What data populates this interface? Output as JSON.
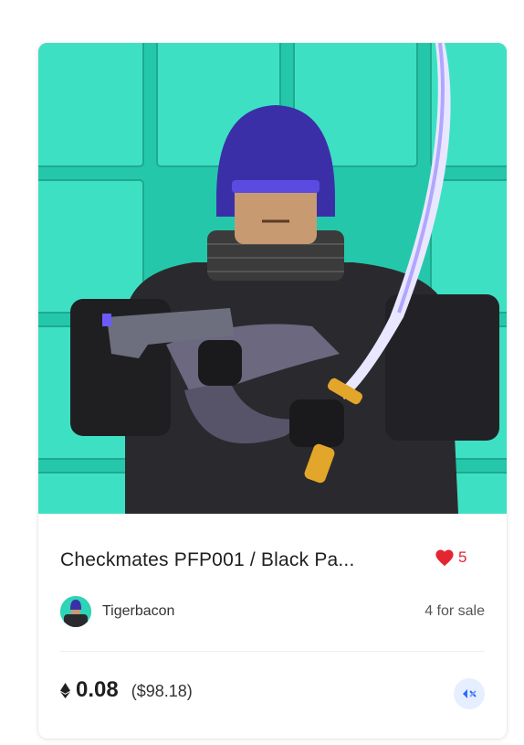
{
  "card": {
    "title": "Checkmates PFP001 / Black Pa...",
    "likes": "5",
    "owner_name": "Tigerbacon",
    "sale_status": "4 for sale",
    "price": "0.08",
    "price_usd": "($98.18)"
  },
  "icons": {
    "like": "heart-icon",
    "currency": "ethereum-icon",
    "chain": "immutable-x-icon"
  },
  "colors": {
    "heart": "#e3262f",
    "background_art": "#2fd3b5",
    "chain_button_bg": "#e6efff",
    "chain_icon": "#2f6bff"
  }
}
